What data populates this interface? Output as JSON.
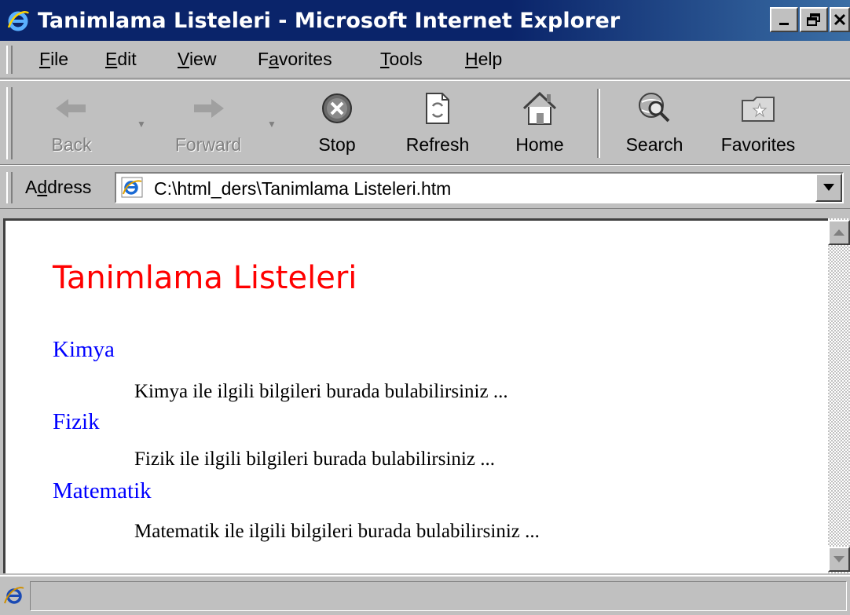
{
  "window": {
    "title": "Tanimlama Listeleri - Microsoft Internet Explorer",
    "controls": {
      "minimize": "_",
      "maximize": "□",
      "close": "✕"
    }
  },
  "menu": {
    "items": [
      {
        "access": "F",
        "rest": "ile"
      },
      {
        "access": "E",
        "rest": "dit"
      },
      {
        "access": "V",
        "rest": "iew"
      },
      {
        "pre": "F",
        "access": "a",
        "rest": "vorites"
      },
      {
        "access": "T",
        "rest": "ools"
      },
      {
        "access": "H",
        "rest": "elp"
      }
    ]
  },
  "toolbar": {
    "back": "Back",
    "forward": "Forward",
    "stop": "Stop",
    "refresh": "Refresh",
    "home": "Home",
    "search": "Search",
    "favorites": "Favorites",
    "icons": [
      "left-arrow-icon",
      "right-arrow-icon",
      "stop-icon",
      "refresh-icon",
      "home-icon",
      "search-globe-icon",
      "favorites-folder-icon"
    ]
  },
  "address": {
    "label_pre": "A",
    "label_access": "d",
    "label_rest": "dress",
    "value": "C:\\html_ders\\Tanimlama Listeleri.htm"
  },
  "page": {
    "title": "Tanimlama Listeleri",
    "definitions": [
      {
        "term": "Kimya",
        "description": "Kimya ile ilgili bilgileri burada bulabilirsiniz ..."
      },
      {
        "term": "Fizik",
        "description": "Fizik ile ilgili bilgileri burada bulabilirsiniz ..."
      },
      {
        "term": "Matematik",
        "description": "Matematik ile ilgili bilgileri burada bulabilirsiniz ..."
      }
    ]
  },
  "colors": {
    "title_bar": "#0a246a",
    "chrome": "#c0c0c0",
    "page_title": "#ff0000",
    "term_link": "#0000ff"
  }
}
